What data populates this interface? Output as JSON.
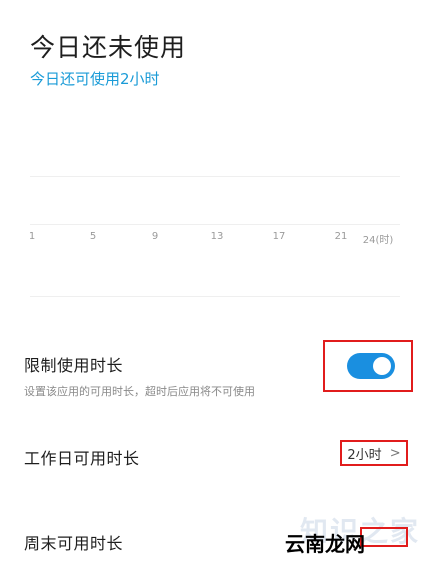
{
  "header": {
    "title": "今日还未使用",
    "subtitle": "今日还可使用2小时"
  },
  "chart_data": {
    "type": "bar",
    "x": [
      "1",
      "5",
      "9",
      "13",
      "17",
      "21",
      "24(时)"
    ],
    "values": [],
    "title": "",
    "xlabel": "",
    "ylabel": ""
  },
  "settings": {
    "limit_title": "限制使用时长",
    "limit_desc": "设置该应用的可用时长，超时后应用将不可使用",
    "limit_enabled": true,
    "weekday_title": "工作日可用时长",
    "weekday_value": "2小时",
    "weekend_title": "周末可用时长"
  },
  "watermark": {
    "text": "云南龙网",
    "faded_text": "知识之家"
  },
  "colors": {
    "accent": "#1a9bd7",
    "toggle_on": "#1a8fe0",
    "highlight_box": "#e11c1c"
  },
  "icons": {
    "chevron": "chevron-right-icon"
  }
}
